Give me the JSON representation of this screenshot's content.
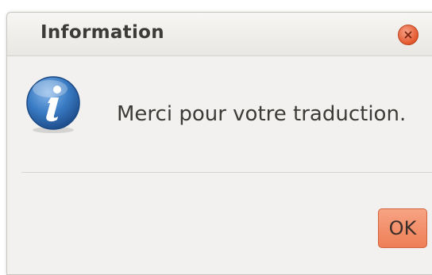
{
  "dialog": {
    "title": "Information",
    "message": "Merci pour votre traduction.",
    "ok_label": "OK",
    "icon": "info-icon",
    "close_icon": "close-icon"
  },
  "colors": {
    "accent": "#ee7f57",
    "close_button": "#e4572c",
    "info_icon": "#2f6fb6",
    "background": "#f2f1ef"
  }
}
